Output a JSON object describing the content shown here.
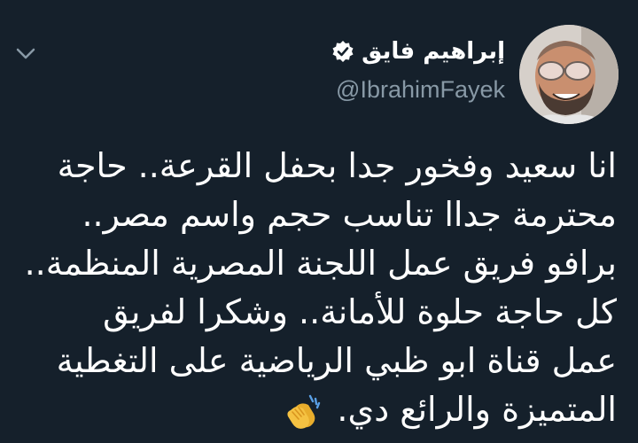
{
  "tweet": {
    "author": {
      "display_name": "إبراهيم فايق",
      "handle": "@IbrahimFayek",
      "verified_icon": "verified-badge-icon"
    },
    "menu_icon": "chevron-down-icon",
    "lines": [
      "انا سعيد وفخور جدا بحفل القرعة.. حاجة",
      "محترمة جداا تناسب حجم واسم مصر..",
      "برافو فريق عمل اللجنة المصرية المنظمة..",
      "كل حاجة حلوة للأمانة.. وشكرا لفريق",
      "عمل قناة ابو ظبي الرياضية على التغطية",
      "المتميزة والرائع دي."
    ],
    "emoji": "clapping-hands-icon"
  },
  "colors": {
    "background": "#15202b",
    "text": "#ffffff",
    "secondary_text": "#8899a6",
    "emoji": "#f5c242"
  }
}
